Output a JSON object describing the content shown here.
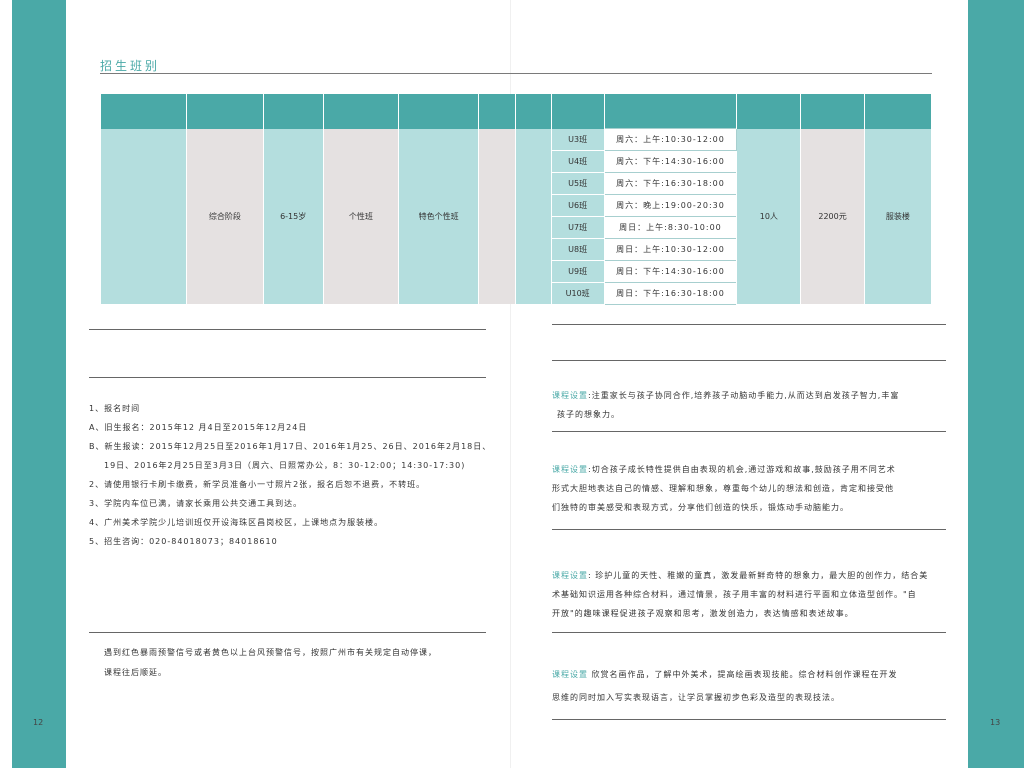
{
  "section_title": "招生班别",
  "table": {
    "stage": "综合阶段",
    "age": "6-15岁",
    "class_type": "个性班",
    "course": "特色个性班",
    "sessions": [
      {
        "code": "U3班",
        "time": "周六：上午:10:30-12:00"
      },
      {
        "code": "U4班",
        "time": "周六：下午:14:30-16:00"
      },
      {
        "code": "U5班",
        "time": "周六：下午:16:30-18:00"
      },
      {
        "code": "U6班",
        "time": "周六：晚上:19:00-20:30"
      },
      {
        "code": "U7班",
        "time": "周日：上午:8:30-10:00"
      },
      {
        "code": "U8班",
        "time": "周日：上午:10:30-12:00"
      },
      {
        "code": "U9班",
        "time": "周日：下午:14:30-16:00"
      },
      {
        "code": "U10班",
        "time": "周日：下午:16:30-18:00"
      }
    ],
    "capacity": "10人",
    "fee": "2200元",
    "location": "服装楼"
  },
  "registration": {
    "lines": [
      "1、报名时间",
      "A、旧生报名：2015年12 月4日至2015年12月24日",
      "B、新生报读：2015年12月25日至2016年1月17日、2016年1月25、26日、2016年2月18日、",
      "19日、2016年2月25日至3月3日（周六、日照常办公，8：30-12:00；14:30-17:30)",
      "2、请使用银行卡刷卡缴费，新学员准备小一寸照片2张，报名后恕不退费，不转班。",
      "3、学院内车位已满，请家长乘用公共交通工具到达。",
      "4、广州美术学院少儿培训班仅开设海珠区昌岗校区，上课地点为服装楼。",
      "5、招生咨询：020-84018073；84018610"
    ],
    "notice_lines": [
      "遇到红色暴雨预警信号或者黄色以上台风预警信号，按照广州市有关规定自动停课，",
      "课程往后顺延。"
    ]
  },
  "courses": [
    {
      "label": "课程设置",
      "lines": [
        ":注重家长与孩子协同合作,培养孩子动脑动手能力,从而达到启发孩子智力,丰富",
        "孩子的想象力。"
      ]
    },
    {
      "label": "课程设置",
      "lines": [
        ":切合孩子成长特性提供自由表现的机会,通过游戏和故事,鼓励孩子用不同艺术",
        "形式大胆地表达自己的情感、理解和想象，尊重每个幼儿的想法和创造，肯定和接受他",
        "们独特的审美感受和表现方式，分享他们创造的快乐，锻炼动手动脑能力。"
      ]
    },
    {
      "label": "课程设置",
      "lines": [
        ": 珍护儿童的天性、稚嫩的童真，激发最新鲜奇特的想象力，最大胆的创作力，结合美",
        "术基础知识运用各种综合材料，通过情景，孩子用丰富的材料进行平面和立体造型创作。\"自",
        "开放\"的趣味课程促进孩子观察和思考，激发创造力，表达情感和表述故事。"
      ]
    },
    {
      "label": "课程设置",
      "lines": [
        " 欣赏名画作品，了解中外美术，提高绘画表现技能。综合材料创作课程在开发",
        "思维的同时加入写实表现语言，让学员掌握初步色彩及造型的表现技法。"
      ]
    }
  ],
  "page_numbers": {
    "left": "12",
    "right": "13"
  }
}
